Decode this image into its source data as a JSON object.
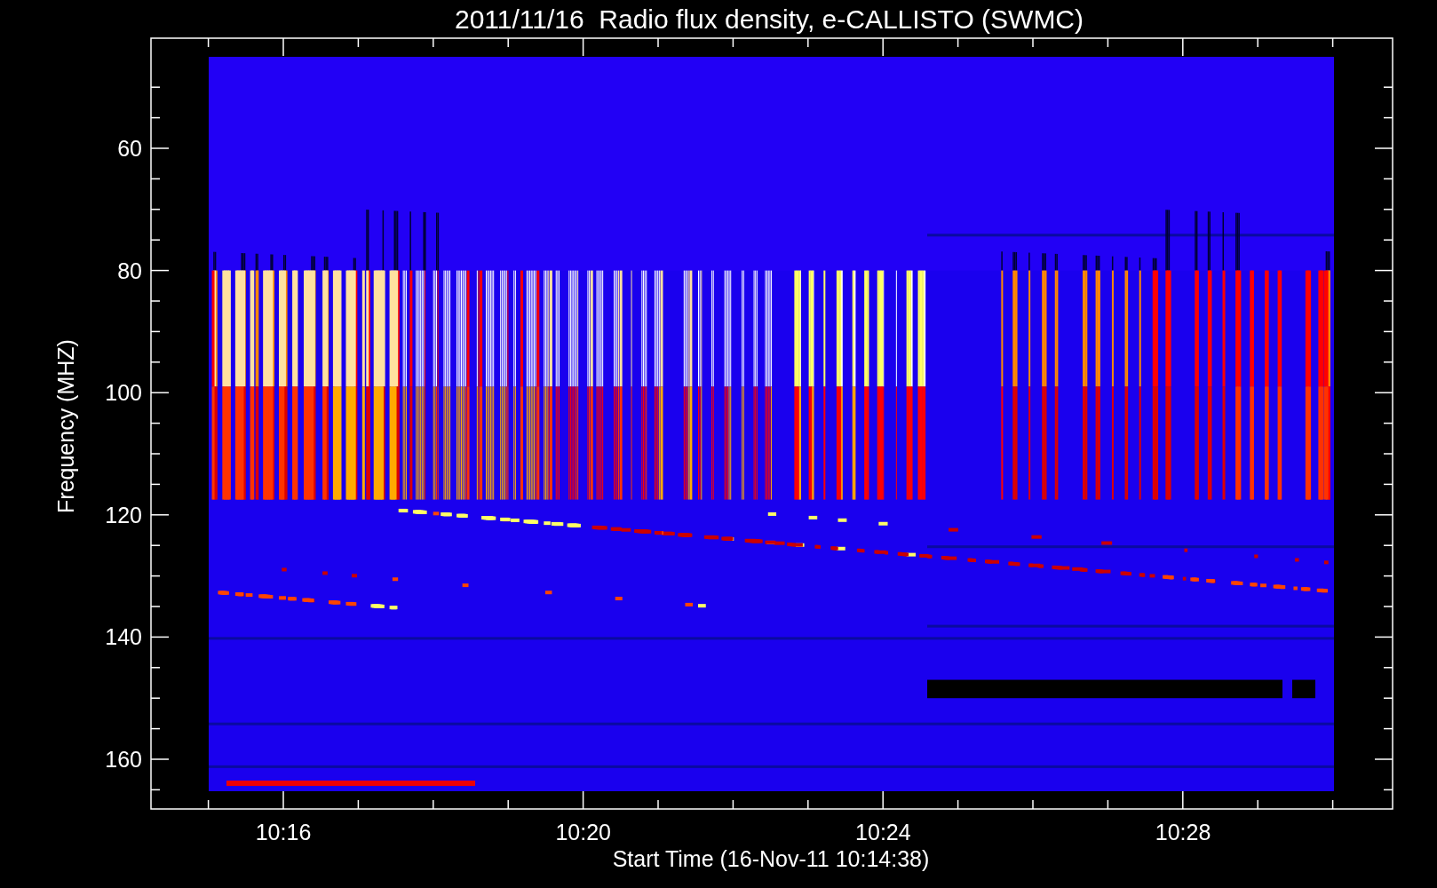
{
  "chart": {
    "title": "2011/11/16  Radio flux density, e-CALLISTO (SWMC)",
    "y_axis": {
      "label": "Frequency (MHZ)",
      "ticks": [
        "60",
        "80",
        "100",
        "120",
        "140",
        "160"
      ]
    },
    "x_axis": {
      "label": "Start Time (16-Nov-11 10:14:38)",
      "ticks": [
        "10:16",
        "10:20",
        "10:24",
        "10:28"
      ]
    }
  }
}
